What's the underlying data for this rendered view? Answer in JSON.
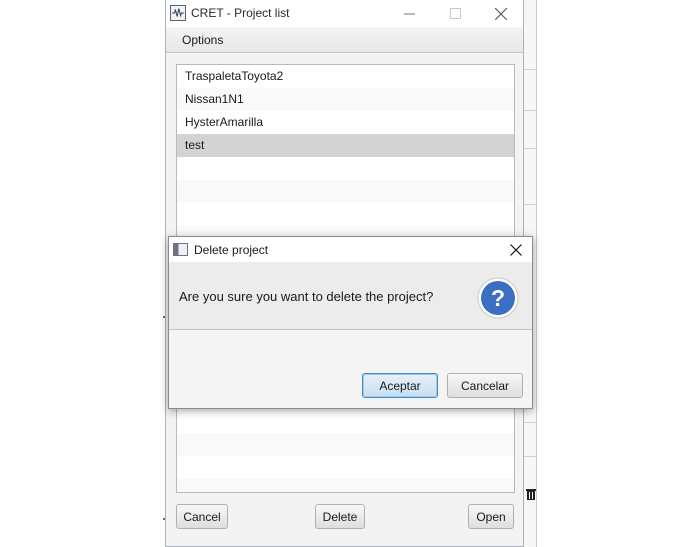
{
  "main_window": {
    "title": "CRET - Project list",
    "menu": {
      "options_label": "Options"
    },
    "projects": [
      {
        "name": "TraspaletaToyota2",
        "selected": false
      },
      {
        "name": "Nissan1N1",
        "selected": false
      },
      {
        "name": "HysterAmarilla",
        "selected": false
      },
      {
        "name": "test",
        "selected": true
      }
    ],
    "buttons": {
      "cancel": "Cancel",
      "delete": "Delete",
      "open": "Open"
    }
  },
  "dialog": {
    "title": "Delete project",
    "message": "Are you sure you want to delete the project?",
    "icon": "question-icon",
    "buttons": {
      "accept": "Aceptar",
      "decline": "Cancelar"
    }
  },
  "colors": {
    "selected_row": "#d3d3d3",
    "default_button_border": "#3c8fc9",
    "question_icon": "#3a6fc4"
  }
}
